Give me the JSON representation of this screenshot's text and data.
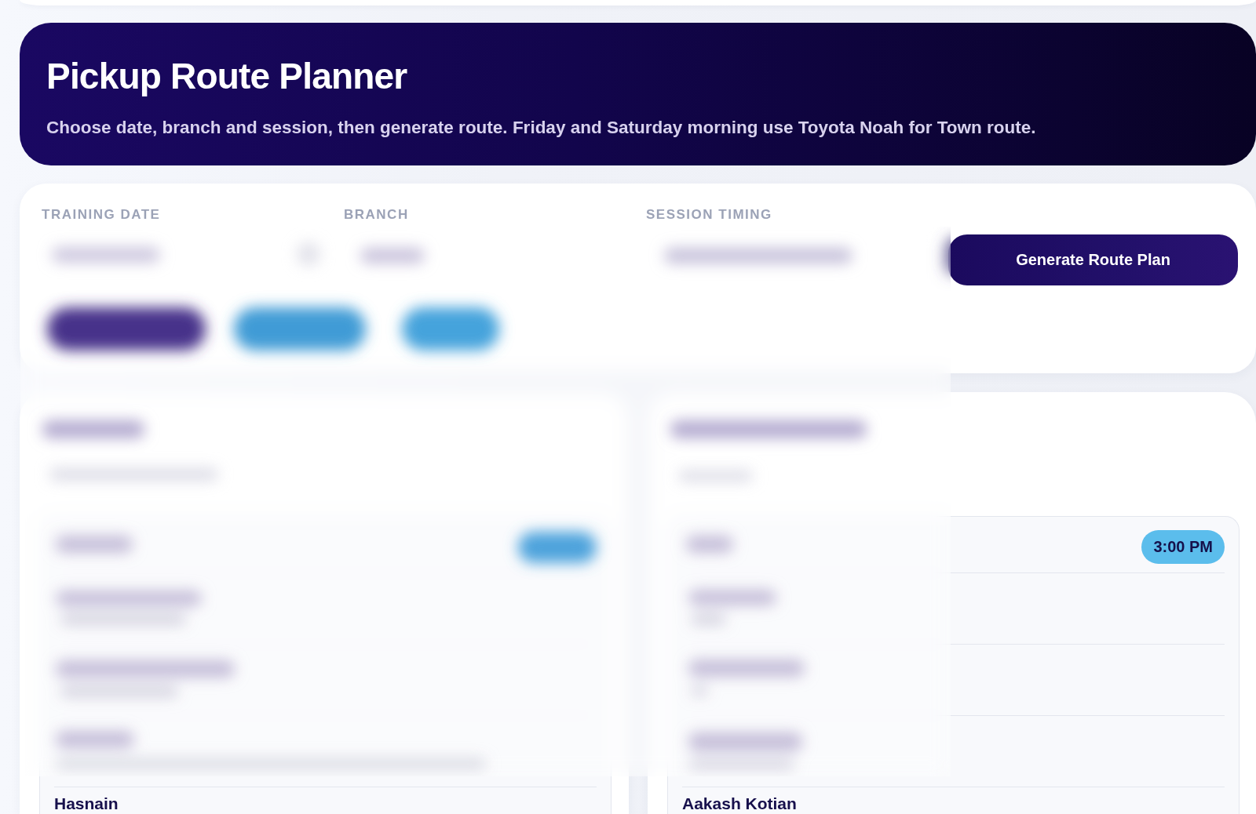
{
  "header": {
    "title": "Pickup Route Planner",
    "subtitle": "Choose date, branch and session, then generate route. Friday and Saturday morning use Toyota Noah for Town route."
  },
  "form": {
    "fields": [
      {
        "label": "TRAINING DATE"
      },
      {
        "label": "BRANCH"
      },
      {
        "label": "SESSION TIMING"
      }
    ],
    "generate_button": "Generate Route Plan"
  },
  "routes": [
    {
      "stops": [
        {
          "name": "Hasnain"
        }
      ]
    },
    {
      "time": "3:00 PM",
      "stops": [
        {
          "name": "Aakash Kotian"
        }
      ]
    }
  ]
}
